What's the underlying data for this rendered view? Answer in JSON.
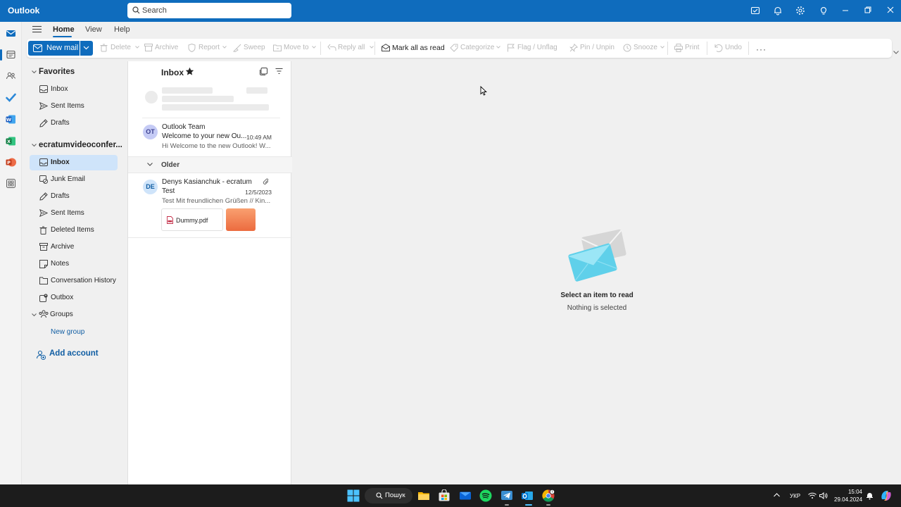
{
  "app": {
    "title": "Outlook",
    "search_placeholder": "Search"
  },
  "ribbon": {
    "tabs": [
      "Home",
      "View",
      "Help"
    ],
    "active_tab": "Home",
    "new_mail": "New mail",
    "tools": {
      "delete": "Delete",
      "archive": "Archive",
      "report": "Report",
      "sweep": "Sweep",
      "move_to": "Move to",
      "reply_all": "Reply all",
      "mark_all_read": "Mark all as read",
      "categorize": "Categorize",
      "flag": "Flag / Unflag",
      "pin": "Pin / Unpin",
      "snooze": "Snooze",
      "print": "Print",
      "undo": "Undo",
      "more": "···"
    }
  },
  "folders": {
    "favorites_header": "Favorites",
    "favorites": [
      {
        "label": "Inbox",
        "icon": "inbox-icon"
      },
      {
        "label": "Sent Items",
        "icon": "send-icon"
      },
      {
        "label": "Drafts",
        "icon": "pencil-icon"
      }
    ],
    "account_header": "ecratumvideoconfer...",
    "account_folders": [
      {
        "label": "Inbox",
        "icon": "inbox-icon",
        "selected": true
      },
      {
        "label": "Junk Email",
        "icon": "junk-icon"
      },
      {
        "label": "Drafts",
        "icon": "pencil-icon"
      },
      {
        "label": "Sent Items",
        "icon": "send-icon"
      },
      {
        "label": "Deleted Items",
        "icon": "trash-icon"
      },
      {
        "label": "Archive",
        "icon": "archive-icon"
      },
      {
        "label": "Notes",
        "icon": "note-icon"
      },
      {
        "label": "Conversation History",
        "icon": "folder-icon"
      },
      {
        "label": "Outbox",
        "icon": "outbox-icon"
      }
    ],
    "groups_header": "Groups",
    "new_group": "New group",
    "add_account": "Add account"
  },
  "message_list": {
    "title": "Inbox",
    "older_label": "Older",
    "messages": [
      {
        "initials": "OT",
        "sender": "Outlook Team",
        "subject": "Welcome to your new Ou...",
        "time": "10:49 AM",
        "preview": "Hi Welcome to the new Outlook! W..."
      },
      {
        "initials": "DE",
        "sender": "Denys Kasianchuk - ecratum",
        "subject": "Test",
        "time": "12/5/2023",
        "preview": "Test Mit freundlichen Grüßen // Kin...",
        "attachment": "Dummy.pdf"
      }
    ]
  },
  "reading_pane": {
    "title": "Select an item to read",
    "subtitle": "Nothing is selected"
  },
  "taskbar": {
    "search": "Пошук",
    "language": "УКР",
    "time": "15:04",
    "date": "29.04.2024"
  },
  "colors": {
    "brand": "#0f6cbd",
    "selected_folder": "#cfe4fa",
    "link": "#115ea3"
  }
}
